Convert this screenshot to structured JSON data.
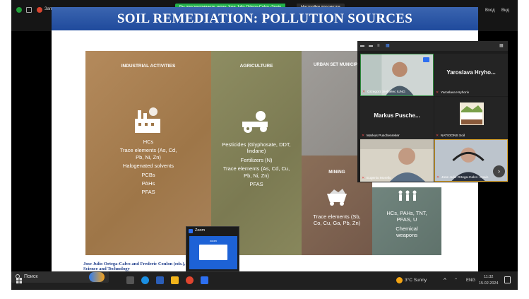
{
  "topbar": {
    "record_label": "Запись",
    "share_banner": "Вы просматриваете экран Jose Julio Ortega-Calvo -Spain",
    "view_options": "Настройки просмотра",
    "signin": "Вход",
    "view": "Вид"
  },
  "slide": {
    "title": "SOIL REMEDIATION: POLLUTION SOURCES",
    "panels": {
      "industrial": {
        "title": "INDUSTRIAL ACTIVITIES",
        "items": [
          "HCs",
          "Trace elements (As, Cd, Pb, Ni, Zn)",
          "Halogenated solvents",
          "PCBs",
          "PAHs",
          "PFAS"
        ]
      },
      "agriculture": {
        "title": "AGRICULTURE",
        "items": [
          "Pesticides (Glyphosate, DDT, lindane)",
          "Fertilizers (N)",
          "Trace elements (As, Cd, Cu, Pb, Ni, Zn)",
          "PFAS"
        ]
      },
      "urban": {
        "title": "URBAN SET MUNICIPA",
        "text": "C"
      },
      "mining": {
        "title": "MINING",
        "items": [
          "Trace elements (Sb, Co, Cu, Ga, Pb, Zn)"
        ]
      },
      "war": {
        "items": [
          "HCs, PAHs, TNT, PFAS, U",
          "Chemical weapons"
        ]
      }
    },
    "citation": "Jose Julio Ortega-Calvo and Frederic Coulon (eds.), Soil Remediation Science and Technology"
  },
  "participants": {
    "tiles": [
      {
        "name": "Grzegorz Siebielec IUNG",
        "display": ""
      },
      {
        "name": "Yaroslava Hryhoriv",
        "display": "Yaroslava Hryho..."
      },
      {
        "name": "Markus Puschenreiter",
        "display": "Markus Pusche..."
      },
      {
        "name": "NATIOONS Soil",
        "display": ""
      },
      {
        "name": "Eugenio Morello",
        "display": ""
      },
      {
        "name": "Jose Julio Ortega-Calvo -Spain",
        "display": ""
      }
    ]
  },
  "zoom_popup": {
    "title": "Zoom",
    "body": "zoom"
  },
  "taskbar": {
    "search_placeholder": "Поиск",
    "weather": "3°C Sunny",
    "lang": "ENG",
    "time": "11:32",
    "date": "15.02.2024"
  },
  "colors": {
    "slide_header": "#2b5aa8",
    "zoom_blue": "#2d6ff0",
    "share_green": "#23b04a"
  }
}
